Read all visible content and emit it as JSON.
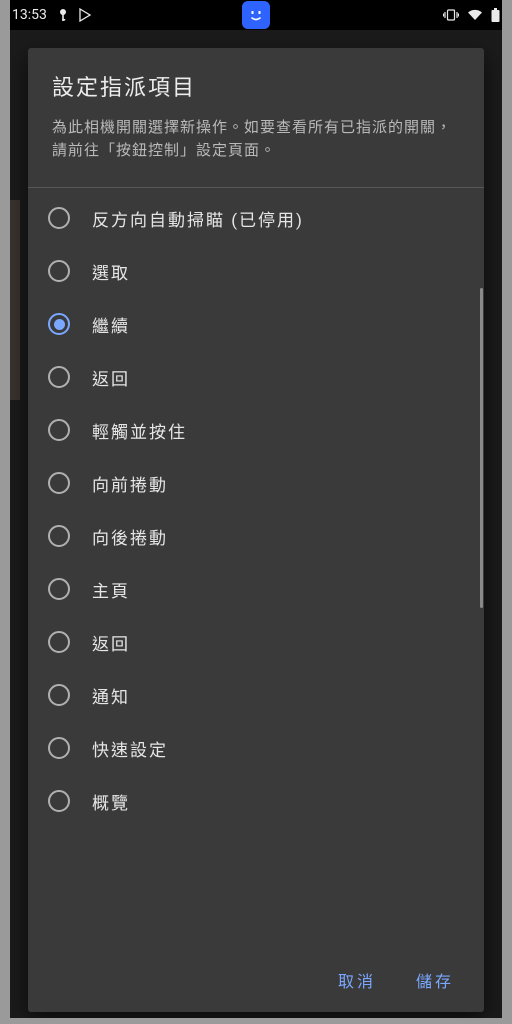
{
  "status": {
    "time": "13:53"
  },
  "dialog": {
    "title": "設定指派項目",
    "description": "為此相機開關選擇新操作。如要查看所有已指派的開關，請前往「按鈕控制」設定頁面。",
    "selected_index": 2,
    "options": [
      {
        "label": "反方向自動掃瞄 (已停用)"
      },
      {
        "label": "選取"
      },
      {
        "label": "繼續"
      },
      {
        "label": "返回"
      },
      {
        "label": "輕觸並按住"
      },
      {
        "label": "向前捲動"
      },
      {
        "label": "向後捲動"
      },
      {
        "label": "主頁"
      },
      {
        "label": "返回"
      },
      {
        "label": "通知"
      },
      {
        "label": "快速設定"
      },
      {
        "label": "概覽"
      }
    ],
    "cancel": "取消",
    "save": "儲存"
  }
}
